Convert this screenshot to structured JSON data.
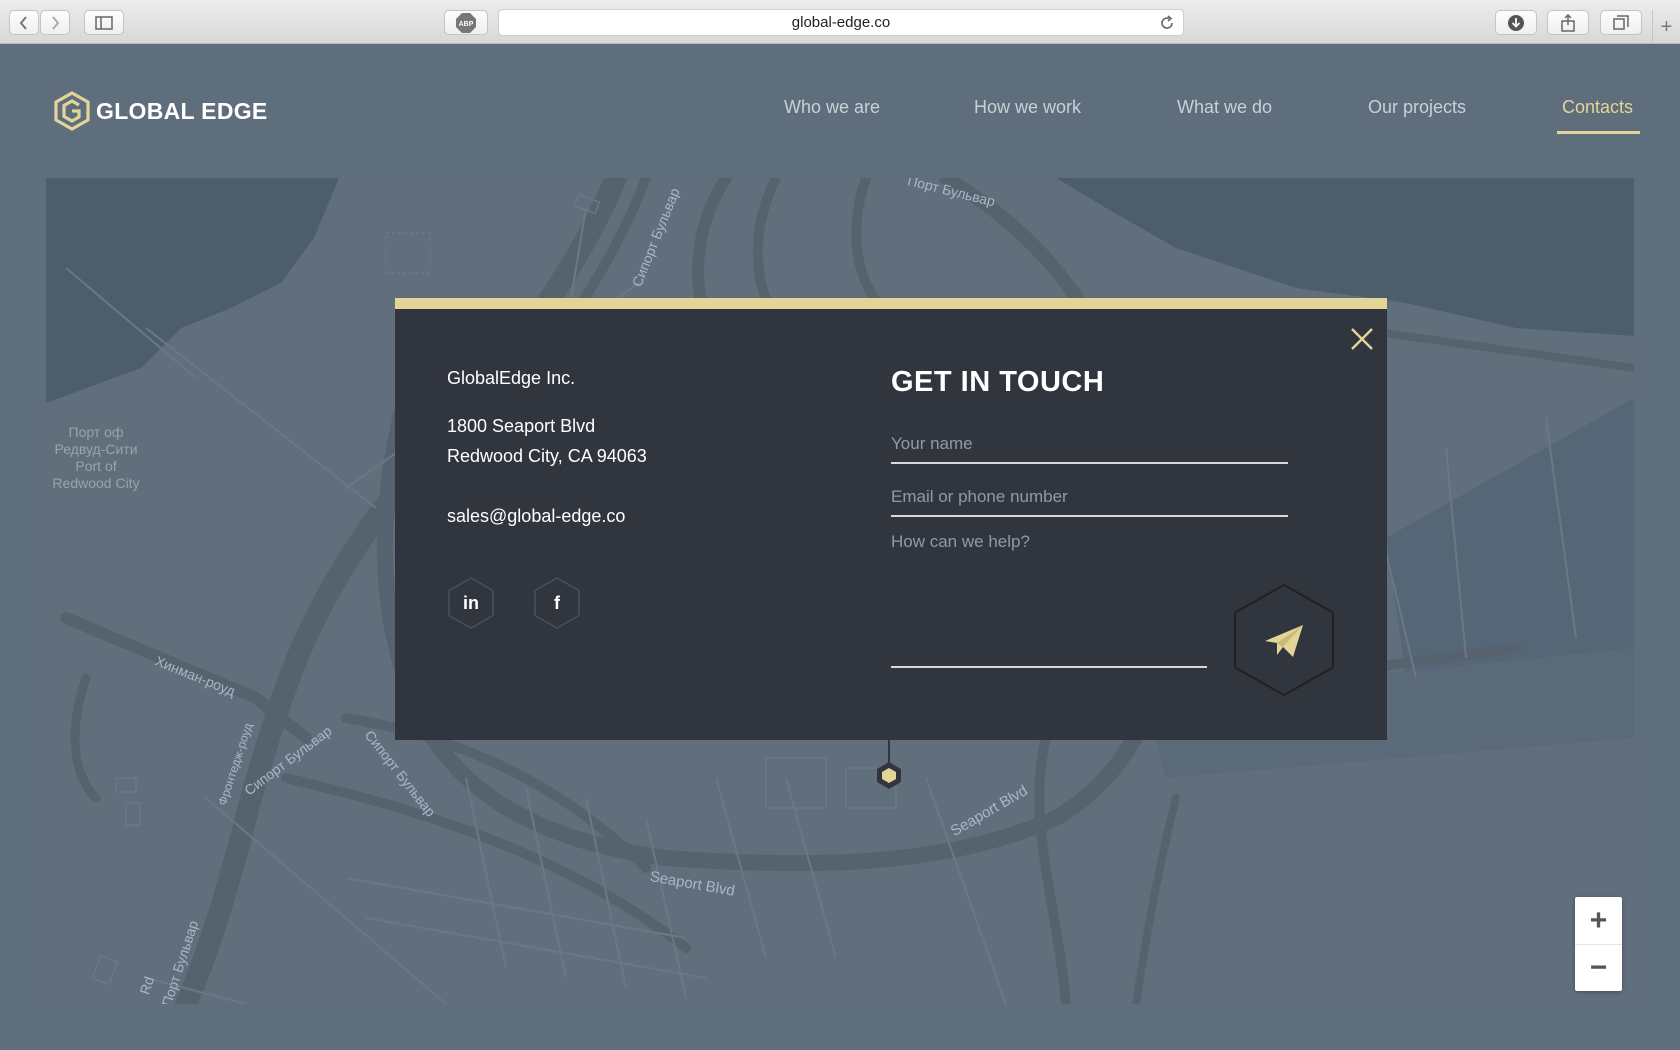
{
  "browser": {
    "url": "global-edge.co",
    "adblock_label": "ABP",
    "new_tab_symbol": "+"
  },
  "site": {
    "logo_text": "GLOBAL EDGE",
    "nav": [
      {
        "label": "Who we are",
        "active": false
      },
      {
        "label": "How we work",
        "active": false
      },
      {
        "label": "What we do",
        "active": false
      },
      {
        "label": "Our projects",
        "active": false
      },
      {
        "label": "Contacts",
        "active": true
      }
    ],
    "accent_color": "#e3d597"
  },
  "map": {
    "labels": {
      "port_line1": "Порт оф",
      "port_line2": "Редвуд-Сити",
      "port_line3": "Port of",
      "port_line4": "Redwood City",
      "siport_top": "Порт Бульвар",
      "siport_left": "Сипорт Бульвар",
      "hinman": "Хинман-роуд",
      "frontage": "Фронтедж-роуд",
      "siport_lower": "Сипорт Бульвар",
      "siport_mid": "Сипорт Бульвар",
      "seaport_blvd_bottom": "Seaport Blvd",
      "seaport_blvd_right": "Seaport Blvd",
      "port_blvd_bottom": "Порт Бульвар",
      "rd": "Rd"
    },
    "zoom_in": "+",
    "zoom_out": "−"
  },
  "contact": {
    "company": "GlobalEdge Inc.",
    "address_line1": "1800 Seaport Blvd",
    "address_line2": "Redwood City, CA 94063",
    "email": "sales@global-edge.co",
    "social": [
      {
        "label": "in",
        "icon": "linkedin-icon"
      },
      {
        "label": "f",
        "icon": "facebook-icon"
      }
    ],
    "heading": "GET IN TOUCH",
    "name_placeholder": "Your name",
    "email_placeholder": "Email or phone number",
    "help_placeholder": "How can we help?"
  }
}
